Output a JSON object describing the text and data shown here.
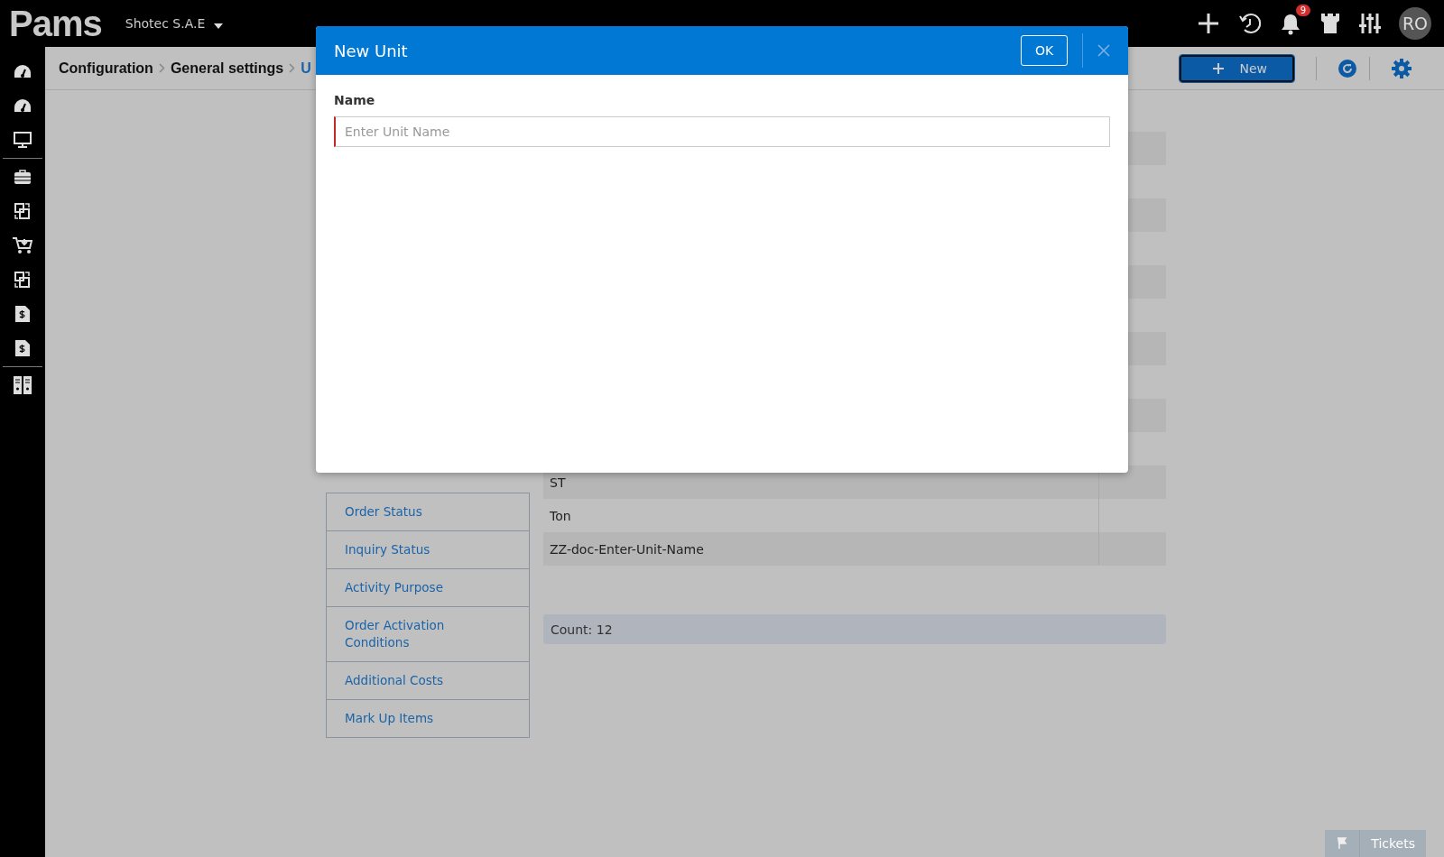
{
  "header": {
    "logo": "Pams",
    "company": "Shotec S.A.E",
    "notification_count": "9",
    "avatar": "RO"
  },
  "breadcrumb": [
    "Configuration",
    "General settings",
    "U"
  ],
  "toolbar": {
    "new_button": "New"
  },
  "settings_menu": [
    {
      "label": "Order Status"
    },
    {
      "label": "Inquiry Status"
    },
    {
      "label": "Activity Purpose"
    },
    {
      "label": "Order Activation Conditions"
    },
    {
      "label": "Additional Costs"
    },
    {
      "label": "Mark Up Items"
    }
  ],
  "table": {
    "rows": [
      {
        "name": "ST"
      },
      {
        "name": "Ton"
      },
      {
        "name": "ZZ-doc-Enter-Unit-Name"
      }
    ],
    "count": "Count: 12"
  },
  "modal": {
    "title": "New Unit",
    "ok_button": "OK",
    "fields": [
      {
        "label": "Name",
        "placeholder": "Enter Unit Name",
        "invalid": true
      }
    ]
  },
  "tickets_button": "Tickets"
}
